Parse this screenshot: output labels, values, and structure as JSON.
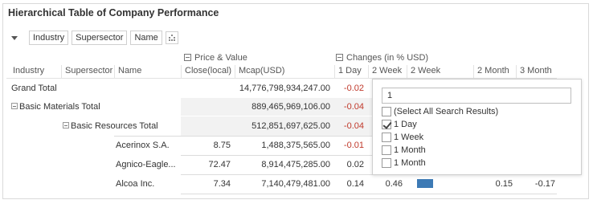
{
  "title": "Hierarchical Table of Company Performance",
  "dimensions": [
    "Industry",
    "Supersector",
    "Name"
  ],
  "groups": {
    "price_value": "Price & Value",
    "changes": "Changes (in % USD)"
  },
  "columns": {
    "industry": "Industry",
    "supersector": "Supersector",
    "name": "Name",
    "close": "Close(local)",
    "mcap": "Mcap(USD)",
    "day1": "1 Day",
    "week2a": "2 Week",
    "week2b": "2 Week",
    "month2": "2 Month",
    "month3": "3 Month"
  },
  "rows": {
    "grand": {
      "label": "Grand Total",
      "mcap": "14,776,798,934,247.00",
      "day1": "-0.02"
    },
    "basic_materials": {
      "label": "Basic Materials Total",
      "mcap": "889,465,969,106.00",
      "day1": "-0.04"
    },
    "basic_resources": {
      "label": "Basic Resources Total",
      "mcap": "512,851,697,625.00",
      "day1": "-0.04"
    },
    "acerinox": {
      "name": "Acerinox S.A.",
      "close": "8.75",
      "mcap": "1,488,375,565.00",
      "day1": "-0.01"
    },
    "agnico": {
      "name": "Agnico-Eagle...",
      "close": "72.47",
      "mcap": "8,914,475,285.00",
      "day1": "0.02"
    },
    "alcoa": {
      "name": "Alcoa Inc.",
      "close": "7.34",
      "mcap": "7,140,479,481.00",
      "day1": "0.14",
      "week2": "0.46",
      "month2": "0.15",
      "month3": "-0.17"
    }
  },
  "filter_popup": {
    "search_value": "1",
    "options": [
      {
        "label": "(Select All Search Results)",
        "checked": false
      },
      {
        "label": "1 Day",
        "checked": true
      },
      {
        "label": "1 Week",
        "checked": false
      },
      {
        "label": "1 Month",
        "checked": false
      },
      {
        "label": "1 Month",
        "checked": false
      }
    ]
  },
  "colors": {
    "negative": "#c0392b",
    "bar": "#3d7ab5"
  }
}
